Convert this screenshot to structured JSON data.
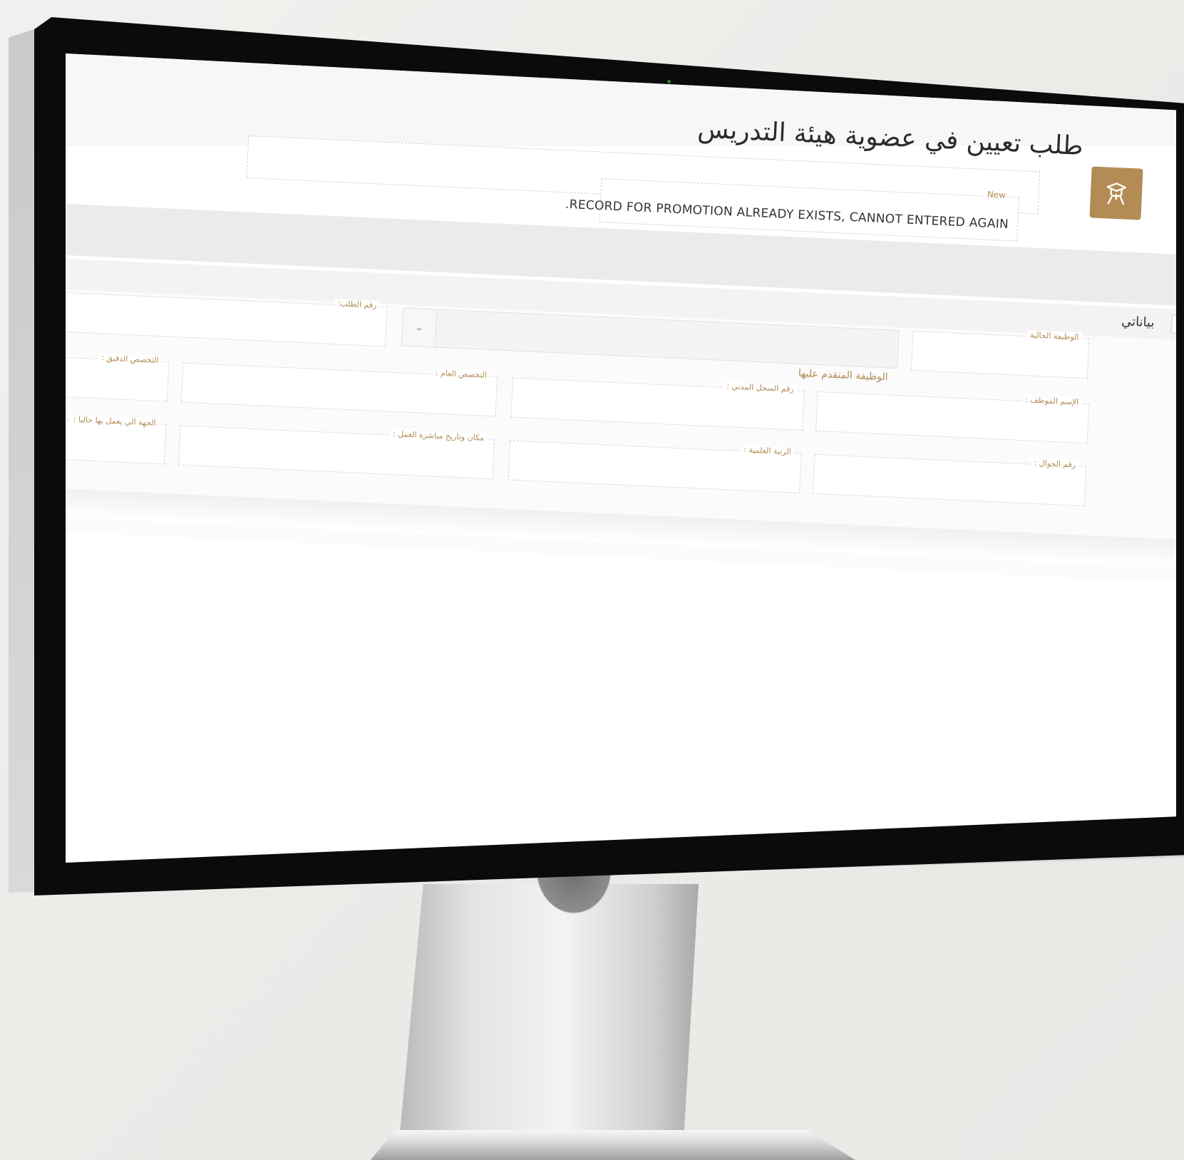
{
  "page": {
    "title": "طلب تعيين في عضوية هيئة التدريس",
    "status_caption": "New",
    "status_message": ".RECORD FOR PROMOTION ALREADY EXISTS, CANNOT ENTERED AGAIN",
    "badge_icon": "graduation-cap-icon",
    "accent_color": "#b28b55"
  },
  "section": {
    "title": "بياناتي",
    "collapse_symbol": "–"
  },
  "form": {
    "request_number_label": "رقم الطلب:",
    "applied_position_select": "الوظيفة المتقدم عليها",
    "current_position_label": "الوظيفة الحالية",
    "general_specialty_label": "التخصص العام :",
    "specific_specialty_label": "التخصص الدقيق :",
    "civil_record_label": "رقم السجل المدني :",
    "employee_name_label": "الإسم الموظف :",
    "work_place_date_label": "مكان وتاريخ مباشرة العمل :",
    "current_employer_label": "الجهة الي يعمل بها حاليا :",
    "academic_rank_label": "الرتبة العلمية :",
    "mobile_number_label": "رقم الجوال :"
  }
}
